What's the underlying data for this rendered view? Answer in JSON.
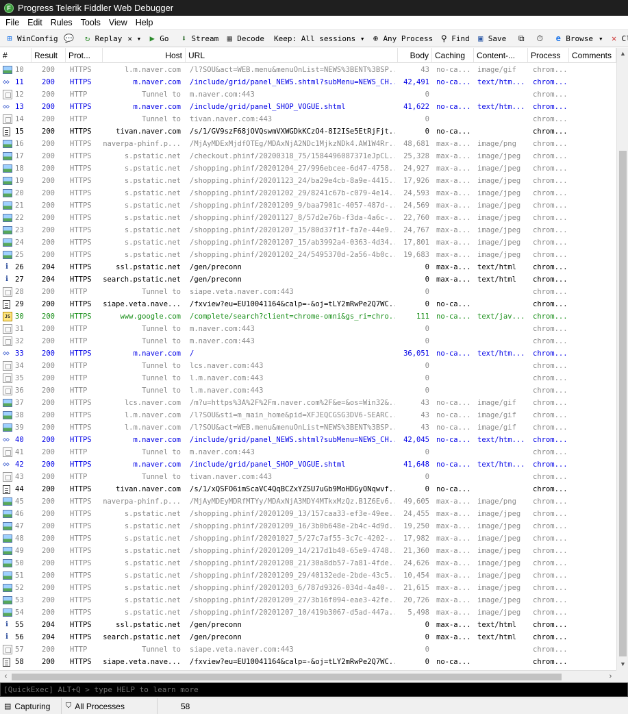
{
  "window": {
    "title": "Progress Telerik Fiddler Web Debugger"
  },
  "menu": [
    "File",
    "Edit",
    "Rules",
    "Tools",
    "View",
    "Help"
  ],
  "toolbar": {
    "winconfig": "WinConfig",
    "replay": "Replay",
    "remove": "✕ ▾",
    "go": "Go",
    "stream": "Stream",
    "decode": "Decode",
    "keep": "Keep: All sessions ▾",
    "any_process": "Any Process",
    "find": "Find",
    "save": "Save",
    "browse": "Browse",
    "browse_arrow": "▾",
    "clear_cache": "Clear Cache"
  },
  "columns": [
    "#",
    "Result",
    "Prot...",
    "Host",
    "URL",
    "Body",
    "Caching",
    "Content-...",
    "Process",
    "Comments"
  ],
  "sessions": [
    {
      "num": "10",
      "result": "200",
      "prot": "HTTPS",
      "host": "l.m.naver.com",
      "url": "/l?SOU&act=WEB.menu&menuOnList=NEWS%3BENT%3BSP...",
      "body": "43",
      "caching": "no-ca...",
      "ctype": "image/gif",
      "process": "chrom...",
      "icon": "image",
      "color": "gray"
    },
    {
      "num": "11",
      "result": "200",
      "prot": "HTTPS",
      "host": "m.naver.com",
      "url": "/include/grid/panel_NEWS.shtml?subMenu=NEWS_CH...",
      "body": "42,491",
      "caching": "no-ca...",
      "ctype": "text/htm...",
      "process": "chrom...",
      "icon": "html",
      "color": "blue"
    },
    {
      "num": "12",
      "result": "200",
      "prot": "HTTP",
      "host": "Tunnel to",
      "url": "m.naver.com:443",
      "body": "0",
      "caching": "",
      "ctype": "",
      "process": "chrom...",
      "icon": "tunnel",
      "color": "gray"
    },
    {
      "num": "13",
      "result": "200",
      "prot": "HTTPS",
      "host": "m.naver.com",
      "url": "/include/grid/panel_SHOP_VOGUE.shtml",
      "body": "41,622",
      "caching": "no-ca...",
      "ctype": "text/htm...",
      "process": "chrom...",
      "icon": "html",
      "color": "blue"
    },
    {
      "num": "14",
      "result": "200",
      "prot": "HTTP",
      "host": "Tunnel to",
      "url": "tivan.naver.com:443",
      "body": "0",
      "caching": "",
      "ctype": "",
      "process": "chrom...",
      "icon": "tunnel",
      "color": "gray"
    },
    {
      "num": "15",
      "result": "200",
      "prot": "HTTPS",
      "host": "tivan.naver.com",
      "url": "/s/1/GV9szF68jOVQswmVXWGDkKCzO4-8I2ISe5EtRjFjt...",
      "body": "0",
      "caching": "no-ca...",
      "ctype": "",
      "process": "chrom...",
      "icon": "doc",
      "color": "black"
    },
    {
      "num": "16",
      "result": "200",
      "prot": "HTTPS",
      "host": "naverpa-phinf.p...",
      "url": "/MjAyMDExMjdfOTEg/MDAxNjA2NDc1MjkzNDk4.AW1W4Rr...",
      "body": "48,681",
      "caching": "max-a...",
      "ctype": "image/png",
      "process": "chrom...",
      "icon": "image",
      "color": "gray"
    },
    {
      "num": "17",
      "result": "200",
      "prot": "HTTPS",
      "host": "s.pstatic.net",
      "url": "/checkout.phinf/20200318_75/1584496087371eJpCL...",
      "body": "25,328",
      "caching": "max-a...",
      "ctype": "image/jpeg",
      "process": "chrom...",
      "icon": "image",
      "color": "gray"
    },
    {
      "num": "18",
      "result": "200",
      "prot": "HTTPS",
      "host": "s.pstatic.net",
      "url": "/shopping.phinf/20201204_27/996ebcee-6d47-4758...",
      "body": "24,927",
      "caching": "max-a...",
      "ctype": "image/jpeg",
      "process": "chrom...",
      "icon": "image",
      "color": "gray"
    },
    {
      "num": "19",
      "result": "200",
      "prot": "HTTPS",
      "host": "s.pstatic.net",
      "url": "/shopping.phinf/20201123_24/ba29e4cb-8a9e-4415...",
      "body": "17,926",
      "caching": "max-a...",
      "ctype": "image/jpeg",
      "process": "chrom...",
      "icon": "image",
      "color": "gray"
    },
    {
      "num": "20",
      "result": "200",
      "prot": "HTTPS",
      "host": "s.pstatic.net",
      "url": "/shopping.phinf/20201202_29/8241c67b-c079-4e14...",
      "body": "24,593",
      "caching": "max-a...",
      "ctype": "image/jpeg",
      "process": "chrom...",
      "icon": "image",
      "color": "gray"
    },
    {
      "num": "21",
      "result": "200",
      "prot": "HTTPS",
      "host": "s.pstatic.net",
      "url": "/shopping.phinf/20201209_9/baa7901c-4057-487d-...",
      "body": "24,569",
      "caching": "max-a...",
      "ctype": "image/jpeg",
      "process": "chrom...",
      "icon": "image",
      "color": "gray"
    },
    {
      "num": "22",
      "result": "200",
      "prot": "HTTPS",
      "host": "s.pstatic.net",
      "url": "/shopping.phinf/20201127_8/57d2e76b-f3da-4a6c-...",
      "body": "22,760",
      "caching": "max-a...",
      "ctype": "image/jpeg",
      "process": "chrom...",
      "icon": "image",
      "color": "gray"
    },
    {
      "num": "23",
      "result": "200",
      "prot": "HTTPS",
      "host": "s.pstatic.net",
      "url": "/shopping.phinf/20201207_15/80d37f1f-fa7e-44e9...",
      "body": "24,767",
      "caching": "max-a...",
      "ctype": "image/jpeg",
      "process": "chrom...",
      "icon": "image",
      "color": "gray"
    },
    {
      "num": "24",
      "result": "200",
      "prot": "HTTPS",
      "host": "s.pstatic.net",
      "url": "/shopping.phinf/20201207_15/ab3992a4-0363-4d34...",
      "body": "17,801",
      "caching": "max-a...",
      "ctype": "image/jpeg",
      "process": "chrom...",
      "icon": "image",
      "color": "gray"
    },
    {
      "num": "25",
      "result": "200",
      "prot": "HTTPS",
      "host": "s.pstatic.net",
      "url": "/shopping.phinf/20201202_24/5495370d-2a56-4b0c...",
      "body": "19,683",
      "caching": "max-a...",
      "ctype": "image/jpeg",
      "process": "chrom...",
      "icon": "image",
      "color": "gray"
    },
    {
      "num": "26",
      "result": "204",
      "prot": "HTTPS",
      "host": "ssl.pstatic.net",
      "url": "/gen/preconn",
      "body": "0",
      "caching": "max-a...",
      "ctype": "text/html",
      "process": "chrom...",
      "icon": "info",
      "color": "black"
    },
    {
      "num": "27",
      "result": "204",
      "prot": "HTTPS",
      "host": "search.pstatic.net",
      "url": "/gen/preconn",
      "body": "0",
      "caching": "max-a...",
      "ctype": "text/html",
      "process": "chrom...",
      "icon": "info",
      "color": "black"
    },
    {
      "num": "28",
      "result": "200",
      "prot": "HTTP",
      "host": "Tunnel to",
      "url": "siape.veta.naver.com:443",
      "body": "0",
      "caching": "",
      "ctype": "",
      "process": "chrom...",
      "icon": "tunnel",
      "color": "gray"
    },
    {
      "num": "29",
      "result": "200",
      "prot": "HTTPS",
      "host": "siape.veta.nave...",
      "url": "/fxview?eu=EU10041164&calp=-&oj=tLY2mRwPe2Q7WC...",
      "body": "0",
      "caching": "no-ca...",
      "ctype": "",
      "process": "chrom...",
      "icon": "doc",
      "color": "black"
    },
    {
      "num": "30",
      "result": "200",
      "prot": "HTTPS",
      "host": "www.google.com",
      "url": "/complete/search?client=chrome-omni&gs_ri=chro...",
      "body": "111",
      "caching": "no-ca...",
      "ctype": "text/jav...",
      "process": "chrom...",
      "icon": "js",
      "color": "green"
    },
    {
      "num": "31",
      "result": "200",
      "prot": "HTTP",
      "host": "Tunnel to",
      "url": "m.naver.com:443",
      "body": "0",
      "caching": "",
      "ctype": "",
      "process": "chrom...",
      "icon": "tunnel",
      "color": "gray"
    },
    {
      "num": "32",
      "result": "200",
      "prot": "HTTP",
      "host": "Tunnel to",
      "url": "m.naver.com:443",
      "body": "0",
      "caching": "",
      "ctype": "",
      "process": "chrom...",
      "icon": "tunnel",
      "color": "gray"
    },
    {
      "num": "33",
      "result": "200",
      "prot": "HTTPS",
      "host": "m.naver.com",
      "url": "/",
      "body": "36,051",
      "caching": "no-ca...",
      "ctype": "text/htm...",
      "process": "chrom...",
      "icon": "html",
      "color": "blue"
    },
    {
      "num": "34",
      "result": "200",
      "prot": "HTTP",
      "host": "Tunnel to",
      "url": "lcs.naver.com:443",
      "body": "0",
      "caching": "",
      "ctype": "",
      "process": "chrom...",
      "icon": "tunnel",
      "color": "gray"
    },
    {
      "num": "35",
      "result": "200",
      "prot": "HTTP",
      "host": "Tunnel to",
      "url": "l.m.naver.com:443",
      "body": "0",
      "caching": "",
      "ctype": "",
      "process": "chrom...",
      "icon": "tunnel",
      "color": "gray"
    },
    {
      "num": "36",
      "result": "200",
      "prot": "HTTP",
      "host": "Tunnel to",
      "url": "l.m.naver.com:443",
      "body": "0",
      "caching": "",
      "ctype": "",
      "process": "chrom...",
      "icon": "tunnel",
      "color": "gray"
    },
    {
      "num": "37",
      "result": "200",
      "prot": "HTTPS",
      "host": "lcs.naver.com",
      "url": "/m?u=https%3A%2F%2Fm.naver.com%2F&e=&os=Win32&...",
      "body": "43",
      "caching": "no-ca...",
      "ctype": "image/gif",
      "process": "chrom...",
      "icon": "image",
      "color": "gray"
    },
    {
      "num": "38",
      "result": "200",
      "prot": "HTTPS",
      "host": "l.m.naver.com",
      "url": "/l?SOU&sti=m_main_home&pid=XFJEQCGSG3DV6-SEARC...",
      "body": "43",
      "caching": "no-ca...",
      "ctype": "image/gif",
      "process": "chrom...",
      "icon": "image",
      "color": "gray"
    },
    {
      "num": "39",
      "result": "200",
      "prot": "HTTPS",
      "host": "l.m.naver.com",
      "url": "/l?SOU&act=WEB.menu&menuOnList=NEWS%3BENT%3BSP...",
      "body": "43",
      "caching": "no-ca...",
      "ctype": "image/gif",
      "process": "chrom...",
      "icon": "image",
      "color": "gray"
    },
    {
      "num": "40",
      "result": "200",
      "prot": "HTTPS",
      "host": "m.naver.com",
      "url": "/include/grid/panel_NEWS.shtml?subMenu=NEWS_CH...",
      "body": "42,045",
      "caching": "no-ca...",
      "ctype": "text/htm...",
      "process": "chrom...",
      "icon": "html",
      "color": "blue"
    },
    {
      "num": "41",
      "result": "200",
      "prot": "HTTP",
      "host": "Tunnel to",
      "url": "m.naver.com:443",
      "body": "0",
      "caching": "",
      "ctype": "",
      "process": "chrom...",
      "icon": "tunnel",
      "color": "gray"
    },
    {
      "num": "42",
      "result": "200",
      "prot": "HTTPS",
      "host": "m.naver.com",
      "url": "/include/grid/panel_SHOP_VOGUE.shtml",
      "body": "41,648",
      "caching": "no-ca...",
      "ctype": "text/htm...",
      "process": "chrom...",
      "icon": "html",
      "color": "blue"
    },
    {
      "num": "43",
      "result": "200",
      "prot": "HTTP",
      "host": "Tunnel to",
      "url": "tivan.naver.com:443",
      "body": "0",
      "caching": "",
      "ctype": "",
      "process": "chrom...",
      "icon": "tunnel",
      "color": "gray"
    },
    {
      "num": "44",
      "result": "200",
      "prot": "HTTPS",
      "host": "tivan.naver.com",
      "url": "/s/1/xQSFO6imScaVC4QqBCZxYZSU7uGb9MoHDGyONqwvf...",
      "body": "0",
      "caching": "no-ca...",
      "ctype": "",
      "process": "chrom...",
      "icon": "doc",
      "color": "black"
    },
    {
      "num": "45",
      "result": "200",
      "prot": "HTTPS",
      "host": "naverpa-phinf.p...",
      "url": "/MjAyMDEyMDRfMTYy/MDAxNjA3MDY4MTkxMzQz.B1Z6Ev6...",
      "body": "49,605",
      "caching": "max-a...",
      "ctype": "image/png",
      "process": "chrom...",
      "icon": "image",
      "color": "gray"
    },
    {
      "num": "46",
      "result": "200",
      "prot": "HTTPS",
      "host": "s.pstatic.net",
      "url": "/shopping.phinf/20201209_13/157caa33-ef3e-49ee...",
      "body": "24,455",
      "caching": "max-a...",
      "ctype": "image/jpeg",
      "process": "chrom...",
      "icon": "image",
      "color": "gray"
    },
    {
      "num": "47",
      "result": "200",
      "prot": "HTTPS",
      "host": "s.pstatic.net",
      "url": "/shopping.phinf/20201209_16/3b0b648e-2b4c-4d9d...",
      "body": "19,250",
      "caching": "max-a...",
      "ctype": "image/jpeg",
      "process": "chrom...",
      "icon": "image",
      "color": "gray"
    },
    {
      "num": "48",
      "result": "200",
      "prot": "HTTPS",
      "host": "s.pstatic.net",
      "url": "/shopping.phinf/20201027_5/27c7af55-3c7c-4202-...",
      "body": "17,982",
      "caching": "max-a...",
      "ctype": "image/jpeg",
      "process": "chrom...",
      "icon": "image",
      "color": "gray"
    },
    {
      "num": "49",
      "result": "200",
      "prot": "HTTPS",
      "host": "s.pstatic.net",
      "url": "/shopping.phinf/20201209_14/217d1b40-65e9-4748...",
      "body": "21,360",
      "caching": "max-a...",
      "ctype": "image/jpeg",
      "process": "chrom...",
      "icon": "image",
      "color": "gray"
    },
    {
      "num": "50",
      "result": "200",
      "prot": "HTTPS",
      "host": "s.pstatic.net",
      "url": "/shopping.phinf/20201208_21/30a8db57-7a81-4fde...",
      "body": "24,626",
      "caching": "max-a...",
      "ctype": "image/jpeg",
      "process": "chrom...",
      "icon": "image",
      "color": "gray"
    },
    {
      "num": "51",
      "result": "200",
      "prot": "HTTPS",
      "host": "s.pstatic.net",
      "url": "/shopping.phinf/20201209_29/40132ede-2bde-43c5...",
      "body": "10,454",
      "caching": "max-a...",
      "ctype": "image/jpeg",
      "process": "chrom...",
      "icon": "image",
      "color": "gray"
    },
    {
      "num": "52",
      "result": "200",
      "prot": "HTTPS",
      "host": "s.pstatic.net",
      "url": "/shopping.phinf/20201203_6/787d9326-034d-4a40-...",
      "body": "21,615",
      "caching": "max-a...",
      "ctype": "image/jpeg",
      "process": "chrom...",
      "icon": "image",
      "color": "gray"
    },
    {
      "num": "53",
      "result": "200",
      "prot": "HTTPS",
      "host": "s.pstatic.net",
      "url": "/shopping.phinf/20201209_27/3b16f094-eae3-42fe...",
      "body": "20,726",
      "caching": "max-a...",
      "ctype": "image/jpeg",
      "process": "chrom...",
      "icon": "image",
      "color": "gray"
    },
    {
      "num": "54",
      "result": "200",
      "prot": "HTTPS",
      "host": "s.pstatic.net",
      "url": "/shopping.phinf/20201207_10/419b3067-d5ad-447a...",
      "body": "5,498",
      "caching": "max-a...",
      "ctype": "image/jpeg",
      "process": "chrom...",
      "icon": "image",
      "color": "gray"
    },
    {
      "num": "55",
      "result": "204",
      "prot": "HTTPS",
      "host": "ssl.pstatic.net",
      "url": "/gen/preconn",
      "body": "0",
      "caching": "max-a...",
      "ctype": "text/html",
      "process": "chrom...",
      "icon": "info",
      "color": "black"
    },
    {
      "num": "56",
      "result": "204",
      "prot": "HTTPS",
      "host": "search.pstatic.net",
      "url": "/gen/preconn",
      "body": "0",
      "caching": "max-a...",
      "ctype": "text/html",
      "process": "chrom...",
      "icon": "info",
      "color": "black"
    },
    {
      "num": "57",
      "result": "200",
      "prot": "HTTP",
      "host": "Tunnel to",
      "url": "siape.veta.naver.com:443",
      "body": "0",
      "caching": "",
      "ctype": "",
      "process": "chrom...",
      "icon": "tunnel",
      "color": "gray"
    },
    {
      "num": "58",
      "result": "200",
      "prot": "HTTPS",
      "host": "siape.veta.nave...",
      "url": "/fxview?eu=EU10041164&calp=-&oj=tLY2mRwPe2Q7WC...",
      "body": "0",
      "caching": "no-ca...",
      "ctype": "",
      "process": "chrom...",
      "icon": "doc",
      "color": "black"
    }
  ],
  "quickexec": {
    "placeholder": "[QuickExec] ALT+Q > type HELP to learn more"
  },
  "status": {
    "capturing": "Capturing",
    "processes": "All Processes",
    "count": "58"
  }
}
